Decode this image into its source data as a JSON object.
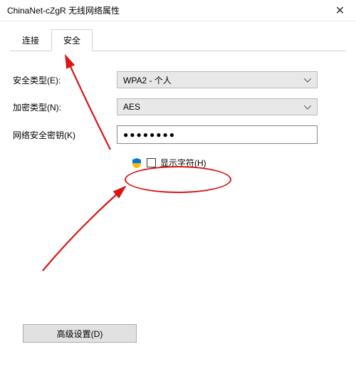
{
  "window": {
    "title": "ChinaNet-cZgR 无线网络属性",
    "close": "✕"
  },
  "tabs": {
    "connect": "连接",
    "security": "安全"
  },
  "form": {
    "security_type_label": "安全类型(E):",
    "security_type_value": "WPA2 - 个人",
    "encryption_label": "加密类型(N):",
    "encryption_value": "AES",
    "key_label": "网络安全密钥(K)",
    "key_value": "●●●●●●●●",
    "show_chars_label": "显示字符(H)"
  },
  "buttons": {
    "advanced": "高级设置(D)"
  }
}
